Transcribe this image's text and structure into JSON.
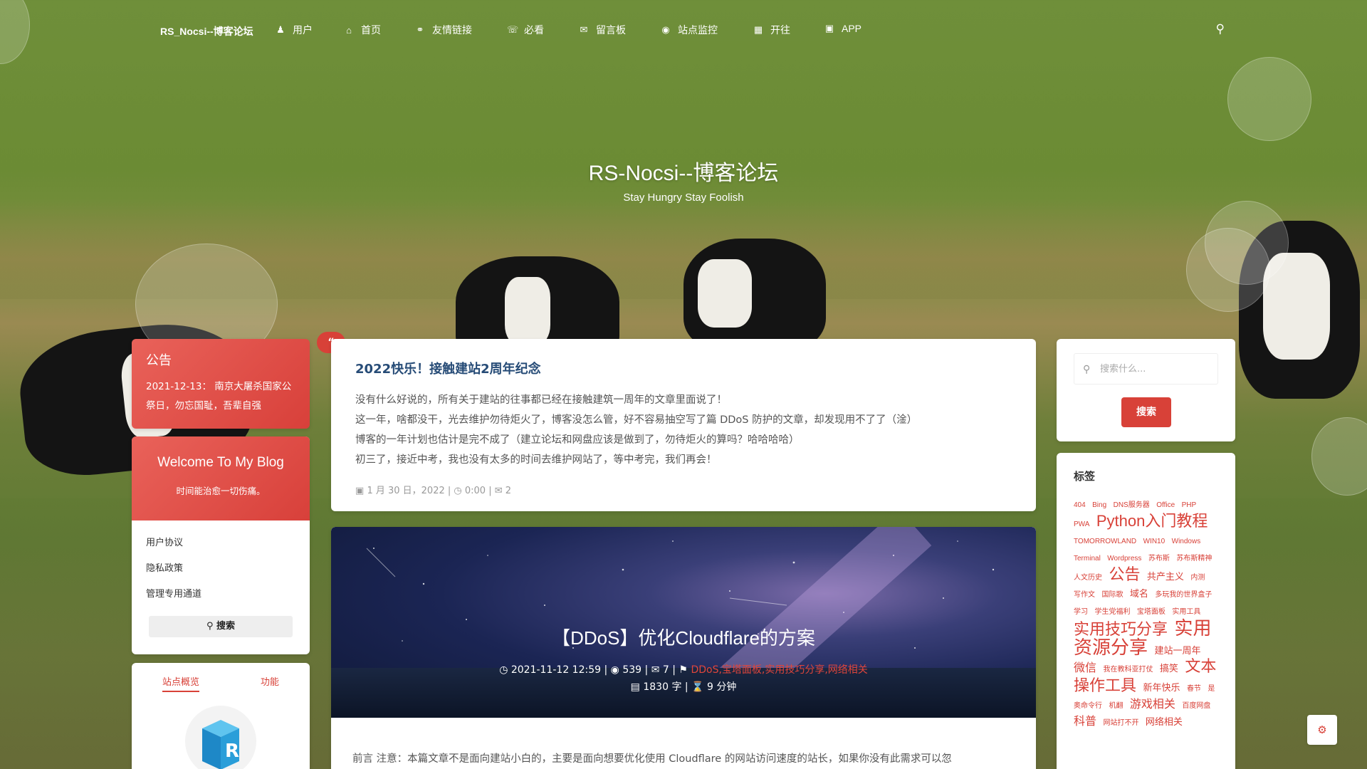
{
  "nav": {
    "brand": "RS_Nocsi--博客论坛",
    "items": [
      {
        "label": "用户",
        "icon": "user-icon"
      },
      {
        "label": "首页",
        "icon": "home-icon"
      },
      {
        "label": "友情链接",
        "icon": "link-icon"
      },
      {
        "label": "必看",
        "icon": "megaphone-icon"
      },
      {
        "label": "留言板",
        "icon": "comment-icon"
      },
      {
        "label": "站点监控",
        "icon": "eye-icon"
      },
      {
        "label": "开往",
        "icon": "train-icon"
      },
      {
        "label": "APP",
        "icon": "briefcase-icon"
      }
    ]
  },
  "hero": {
    "title": "RS-Nocsi--博客论坛",
    "subtitle": "Stay Hungry Stay Foolish"
  },
  "notice": {
    "title": "公告",
    "body": "2021-12-13： 南京大屠杀国家公祭日，勿忘国耻，吾辈自强"
  },
  "welcome": {
    "title": "Welcome To My Blog",
    "subtitle": "时间能治愈一切伤痛。",
    "links": [
      "用户协议",
      "隐私政策",
      "管理专用通道"
    ],
    "search_label": "搜索"
  },
  "stats": {
    "tabs": [
      "站点概览",
      "功能"
    ]
  },
  "post1": {
    "title": "2022快乐！接触建站2周年纪念",
    "lines": [
      "没有什么好说的，所有关于建站的往事都已经在接触建筑一周年的文章里面说了！",
      "这一年，啥都没干，光去维护勿待炬火了，博客没怎么管，好不容易抽空写了篇 DDoS 防护的文章，却发现用不了了（淦）",
      "博客的一年计划也估计是完不成了（建立论坛和网盘应该是做到了，勿待炬火的算吗？哈哈哈哈）",
      "初三了，接近中考，我也没有太多的时间去维护网站了，等中考完，我们再会！"
    ],
    "date": "1 月 30 日，2022",
    "time": "0:00",
    "comments": "2"
  },
  "post2": {
    "title": "【DDoS】优化Cloudflare的方案",
    "datetime": "2021-11-12 12:59",
    "views": "539",
    "comments": "7",
    "tags": "DDoS,宝塔面板,实用技巧分享,网络相关",
    "words": "1830 字",
    "read_time": "9 分钟",
    "excerpt": "前言 注意：本篇文章不是面向建站小白的，主要是面向想要优化使用 Cloudflare 的网站访问速度的站长，如果你没有此需求可以忽"
  },
  "sidebar_search": {
    "placeholder": "搜索什么...",
    "button": "搜索"
  },
  "tags": {
    "heading": "标签",
    "cloud": [
      {
        "t": "404",
        "s": "xs"
      },
      {
        "t": "Bing",
        "s": "xs"
      },
      {
        "t": "DNS服务器",
        "s": "xs"
      },
      {
        "t": "Office",
        "s": "xs"
      },
      {
        "t": "PHP",
        "s": "xs"
      },
      {
        "t": "PWA",
        "s": "xs"
      },
      {
        "t": "Python入门教程",
        "s": "lg"
      },
      {
        "t": "TOMORROWLAND",
        "s": "xs"
      },
      {
        "t": "WIN10",
        "s": "xs"
      },
      {
        "t": "Windows",
        "s": "xs"
      },
      {
        "t": "Terminal",
        "s": "xs"
      },
      {
        "t": "Wordpress",
        "s": "xs"
      },
      {
        "t": "苏布斯",
        "s": "xs"
      },
      {
        "t": "苏布斯精神",
        "s": "xs"
      },
      {
        "t": "人文历史",
        "s": "xs"
      },
      {
        "t": "公告",
        "s": "lg"
      },
      {
        "t": "共产主义",
        "s": "sm"
      },
      {
        "t": "内测",
        "s": "xs"
      },
      {
        "t": "写作文",
        "s": "xs"
      },
      {
        "t": "国际歌",
        "s": "xs"
      },
      {
        "t": "域名",
        "s": "sm"
      },
      {
        "t": "多玩我的世界盒子",
        "s": "xs"
      },
      {
        "t": "学习",
        "s": "xs"
      },
      {
        "t": "学生党福利",
        "s": "xs"
      },
      {
        "t": "宝塔面板",
        "s": "xs"
      },
      {
        "t": "实用工具",
        "s": "xs"
      },
      {
        "t": "实用技巧分享",
        "s": "lg"
      },
      {
        "t": "实用资源分享",
        "s": "xl"
      },
      {
        "t": "建站一周年",
        "s": "sm"
      },
      {
        "t": "微信",
        "s": "md"
      },
      {
        "t": "我在教科亚打仗",
        "s": "xs"
      },
      {
        "t": "搞笑",
        "s": "sm"
      },
      {
        "t": "文本操作工具",
        "s": "lg"
      },
      {
        "t": "新年快乐",
        "s": "sm"
      },
      {
        "t": "春节",
        "s": "xs"
      },
      {
        "t": "是奥命令行",
        "s": "xs"
      },
      {
        "t": "机翻",
        "s": "xs"
      },
      {
        "t": "游戏相关",
        "s": "md"
      },
      {
        "t": "百度网盘",
        "s": "xs"
      },
      {
        "t": "科普",
        "s": "md"
      },
      {
        "t": "网站打不开",
        "s": "xs"
      },
      {
        "t": "网络相关",
        "s": "sm"
      }
    ]
  },
  "colors": {
    "accent": "#d84138",
    "title_blue": "#274c77"
  }
}
